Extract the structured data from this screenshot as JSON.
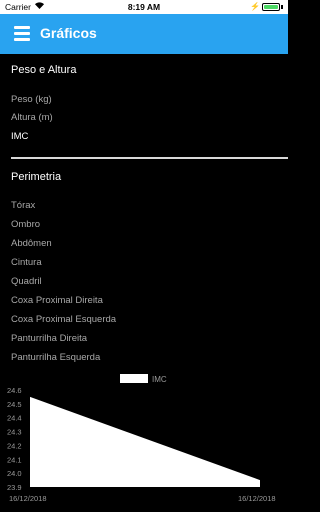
{
  "status_bar": {
    "carrier": "Carrier",
    "time": "8:19 AM"
  },
  "app_bar": {
    "title": "Gráficos"
  },
  "sections": [
    {
      "title": "Peso e Altura",
      "items": [
        "Peso (kg)",
        "Altura (m)",
        "IMC"
      ]
    },
    {
      "title": "Perimetria",
      "items": [
        "Tórax",
        "Ombro",
        "Abdômen",
        "Cintura",
        "Quadril",
        "Coxa Proximal Direita",
        "Coxa Proximal Esquerda",
        "Panturrilha Direita",
        "Panturrilha Esquerda"
      ]
    }
  ],
  "selected_item": "IMC",
  "colors": {
    "app_bar": "#29a3f0",
    "background": "#000000",
    "series": "#ffffff"
  },
  "chart_data": {
    "type": "area",
    "series": [
      {
        "name": "IMC",
        "values": [
          24.55,
          23.95
        ]
      }
    ],
    "x": [
      "16/12/2018",
      "16/12/2018"
    ],
    "yticks": [
      "24.6",
      "24.5",
      "24.4",
      "24.3",
      "24.2",
      "24.1",
      "24.0",
      "23.9"
    ],
    "ylim": [
      23.9,
      24.6
    ],
    "legend": "top-center"
  }
}
